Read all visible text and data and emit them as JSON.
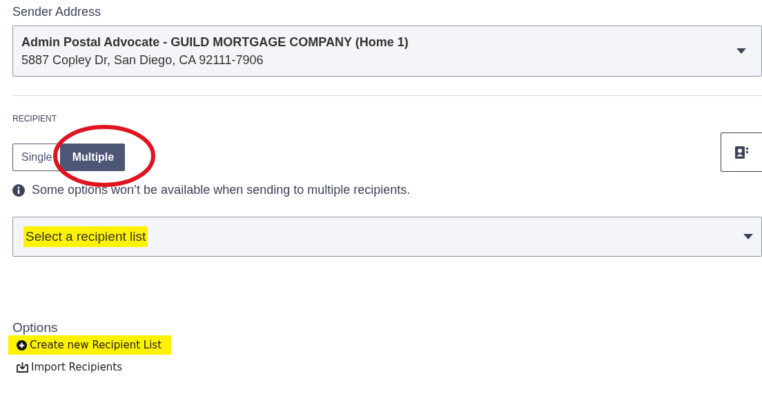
{
  "sender": {
    "label": "Sender Address",
    "name": "Admin Postal Advocate - GUILD MORTGAGE COMPANY (Home 1)",
    "address": "5887 Copley Dr, San Diego, CA 92111-7906"
  },
  "recipient": {
    "label": "RECIPIENT",
    "modes": [
      {
        "label": "Single",
        "selected": false
      },
      {
        "label": "Multiple",
        "selected": true,
        "circled": true
      }
    ],
    "info": "Some options won’t be available when sending to multiple recipients.",
    "list_select": {
      "placeholder": "Select a recipient list",
      "highlighted": true
    }
  },
  "options": {
    "title": "Options",
    "links": [
      {
        "kind": "create",
        "label": "Create new Recipient List",
        "highlighted": true
      },
      {
        "kind": "import",
        "label": "Import Recipients",
        "highlighted": false
      }
    ]
  }
}
